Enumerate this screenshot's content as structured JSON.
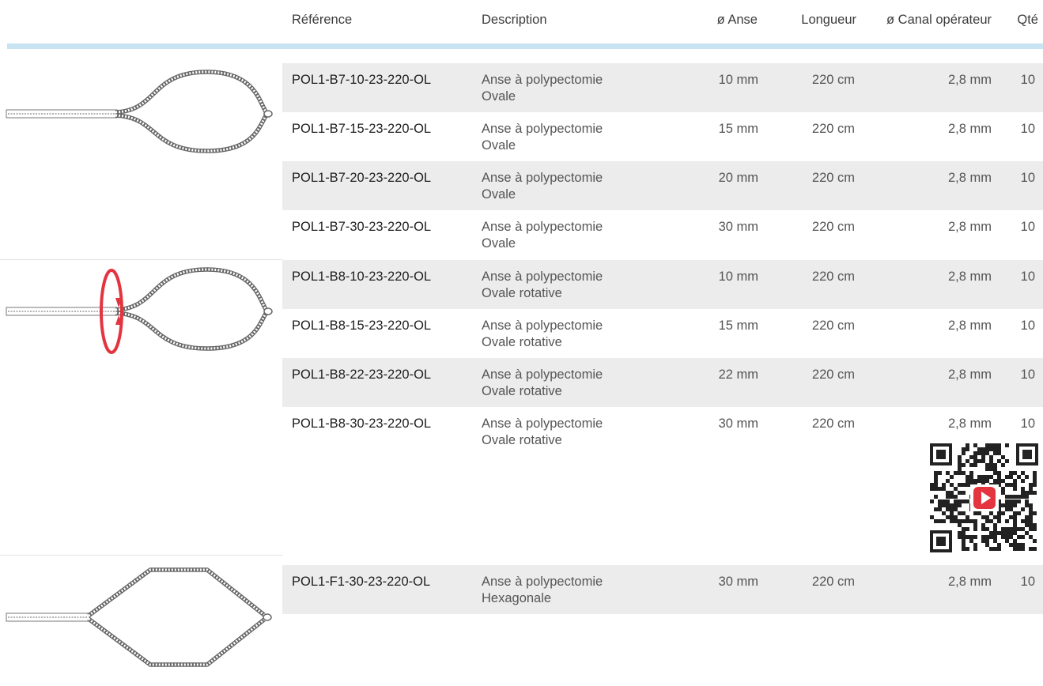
{
  "headers": {
    "reference": "Référence",
    "description": "Description",
    "anse": "ø Anse",
    "longueur": "Longueur",
    "canal": "ø Canal opérateur",
    "qte": "Qté"
  },
  "rows": [
    {
      "ref": "POL1-B7-10-23-220-OL",
      "desc1": "Anse à polypectomie",
      "desc2": "Ovale",
      "anse": "10 mm",
      "longueur": "220 cm",
      "canal": "2,8 mm",
      "qte": "10"
    },
    {
      "ref": "POL1-B7-15-23-220-OL",
      "desc1": "Anse à polypectomie",
      "desc2": "Ovale",
      "anse": "15 mm",
      "longueur": "220 cm",
      "canal": "2,8 mm",
      "qte": "10"
    },
    {
      "ref": "POL1-B7-20-23-220-OL",
      "desc1": "Anse à polypectomie",
      "desc2": "Ovale",
      "anse": "20 mm",
      "longueur": "220 cm",
      "canal": "2,8 mm",
      "qte": "10"
    },
    {
      "ref": "POL1-B7-30-23-220-OL",
      "desc1": "Anse à polypectomie",
      "desc2": "Ovale",
      "anse": "30 mm",
      "longueur": "220 cm",
      "canal": "2,8 mm",
      "qte": "10"
    },
    {
      "ref": "POL1-B8-10-23-220-OL",
      "desc1": "Anse à polypectomie",
      "desc2": "Ovale rotative",
      "anse": "10 mm",
      "longueur": "220 cm",
      "canal": "2,8 mm",
      "qte": "10"
    },
    {
      "ref": "POL1-B8-15-23-220-OL",
      "desc1": "Anse à polypectomie",
      "desc2": "Ovale rotative",
      "anse": "15 mm",
      "longueur": "220 cm",
      "canal": "2,8 mm",
      "qte": "10"
    },
    {
      "ref": "POL1-B8-22-23-220-OL",
      "desc1": "Anse à polypectomie",
      "desc2": "Ovale rotative",
      "anse": "22 mm",
      "longueur": "220 cm",
      "canal": "2,8 mm",
      "qte": "10"
    },
    {
      "ref": "POL1-B8-30-23-220-OL",
      "desc1": "Anse à polypectomie",
      "desc2": "Ovale rotative",
      "anse": "30 mm",
      "longueur": "220 cm",
      "canal": "2,8 mm",
      "qte": "10"
    },
    {
      "ref": "POL1-F1-30-23-220-OL",
      "desc1": "Anse à polypectomie",
      "desc2": "Hexagonale",
      "anse": "30 mm",
      "longueur": "220 cm",
      "canal": "2,8 mm",
      "qte": "10"
    }
  ],
  "colors": {
    "header_bar": "#c8e4f3",
    "row_shade": "#ececec",
    "rotation_arrow": "#e3343f",
    "play_button": "#e3343f"
  },
  "icons": {
    "oval_snare": "oval-snare-illustration",
    "rotating_snare": "rotating-snare-illustration",
    "hexagonal_snare": "hexagonal-snare-illustration",
    "qr_code": "qr-code-icon",
    "play": "play-icon"
  }
}
